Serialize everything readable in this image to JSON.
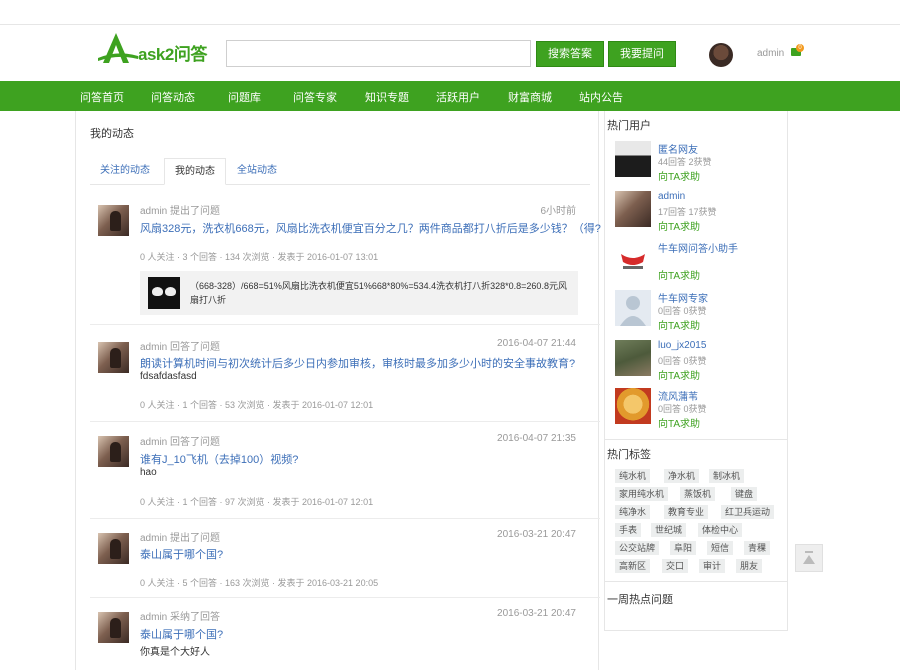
{
  "header": {
    "logo_text": "ask2问答",
    "search": {
      "value": "",
      "placeholder": ""
    },
    "search_button": "搜索答案",
    "ask_button": "我要提问",
    "username": "admin",
    "message_count": "0"
  },
  "nav": {
    "items": [
      "问答首页",
      "问答动态",
      "问题库",
      "问答专家",
      "知识专题",
      "活跃用户",
      "财富商城",
      "站内公告"
    ]
  },
  "main": {
    "title": "我的动态",
    "tabs": [
      "关注的动态",
      "我的动态",
      "全站动态"
    ],
    "active_tab": "我的动态",
    "feed": [
      {
        "user": "admin",
        "action": "提出了问题",
        "time": "6小时前",
        "title": "风扇328元，洗衣机668元，风扇比洗衣机便宜百分之几？两件商品都打八折后是多少钱？（得?",
        "body": "",
        "stats": "0 人关注 · 3 个回答 · 134 次浏览 · 发表于 2016-01-07 13:01",
        "quote": "（668-328）/668=51%风扇比洗衣机便宜51%668*80%=534.4洗衣机打八折328*0.8=260.8元风扇打八折"
      },
      {
        "user": "admin",
        "action": "回答了问题",
        "time": "2016-04-07 21:44",
        "title": "朗读计算机时间与初次统计后多少日内参加审核，审核时最多加多少小时的安全事故教育?",
        "body": "fdsafdasfasd",
        "stats": "0 人关注 · 1 个回答 · 53 次浏览 · 发表于 2016-01-07 12:01",
        "quote": ""
      },
      {
        "user": "admin",
        "action": "回答了问题",
        "time": "2016-04-07 21:35",
        "title": "谁有J_10飞机（去掉100）视频?",
        "body": "hao",
        "stats": "0 人关注 · 1 个回答 · 97 次浏览 · 发表于 2016-01-07 12:01",
        "quote": ""
      },
      {
        "user": "admin",
        "action": "提出了问题",
        "time": "2016-03-21 20:47",
        "title": "泰山属于哪个国?",
        "body": "",
        "stats": "0 人关注 · 5 个回答 · 163 次浏览 · 发表于 2016-03-21 20:05",
        "quote": ""
      },
      {
        "user": "admin",
        "action": "采纳了回答",
        "time": "2016-03-21 20:47",
        "title": "泰山属于哪个国?",
        "body": "你真是个大好人",
        "stats": "",
        "quote": ""
      }
    ]
  },
  "sidebar": {
    "hot_users_title": "热门用户",
    "hot_users": [
      {
        "name": "匿名网友",
        "stats": "44回答  2获赞",
        "ask": "向TA求助"
      },
      {
        "name": "admin",
        "stats": "17回答  17获赞",
        "ask": "向TA求助"
      },
      {
        "name": "牛车网问答小助手",
        "stats": "",
        "ask": "向TA求助"
      },
      {
        "name": "牛车网专家",
        "stats": "0回答  0获赞",
        "ask": "向TA求助"
      },
      {
        "name": "luo_jx2015",
        "stats": "0回答  0获赞",
        "ask": "向TA求助"
      },
      {
        "name": "流风蒲苇",
        "stats": "0回答  0获赞",
        "ask": "向TA求助"
      }
    ],
    "hot_tags_title": "热门标签",
    "tags": [
      [
        "纯水机",
        "净水机",
        "制冰机"
      ],
      [
        "家用纯水机",
        "蒸饭机",
        "键盘"
      ],
      [
        "纯净水",
        "教育专业",
        "红卫兵运动"
      ],
      [
        "手表",
        "世纪城",
        "体检中心"
      ],
      [
        "公交站牌",
        "阜阳",
        "短信",
        "青稞"
      ],
      [
        "高新区",
        "交口",
        "审计",
        "朋友"
      ]
    ],
    "week_hot_title": "一周热点问题"
  },
  "colors": {
    "brand_green": "#3ea220",
    "link_blue": "#3d6fb8"
  }
}
